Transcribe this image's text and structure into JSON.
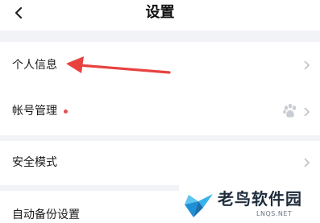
{
  "header": {
    "title": "设置",
    "back_icon": "chevron-left-icon"
  },
  "settings": {
    "items": [
      {
        "label": "个人信息",
        "chevron_icon": "chevron-right-icon"
      },
      {
        "label": "帐号管理",
        "badge": "red-dot",
        "linked_icon": "baidu-paw-icon",
        "chevron_icon": "chevron-right-icon"
      },
      {
        "label": "安全模式",
        "chevron_icon": "chevron-right-icon"
      },
      {
        "label": "自动备份设置"
      }
    ]
  },
  "annotation": {
    "arrow_color": "#e8423f"
  },
  "watermark": {
    "name": "老鸟软件园",
    "url": "LNQS.NET"
  }
}
